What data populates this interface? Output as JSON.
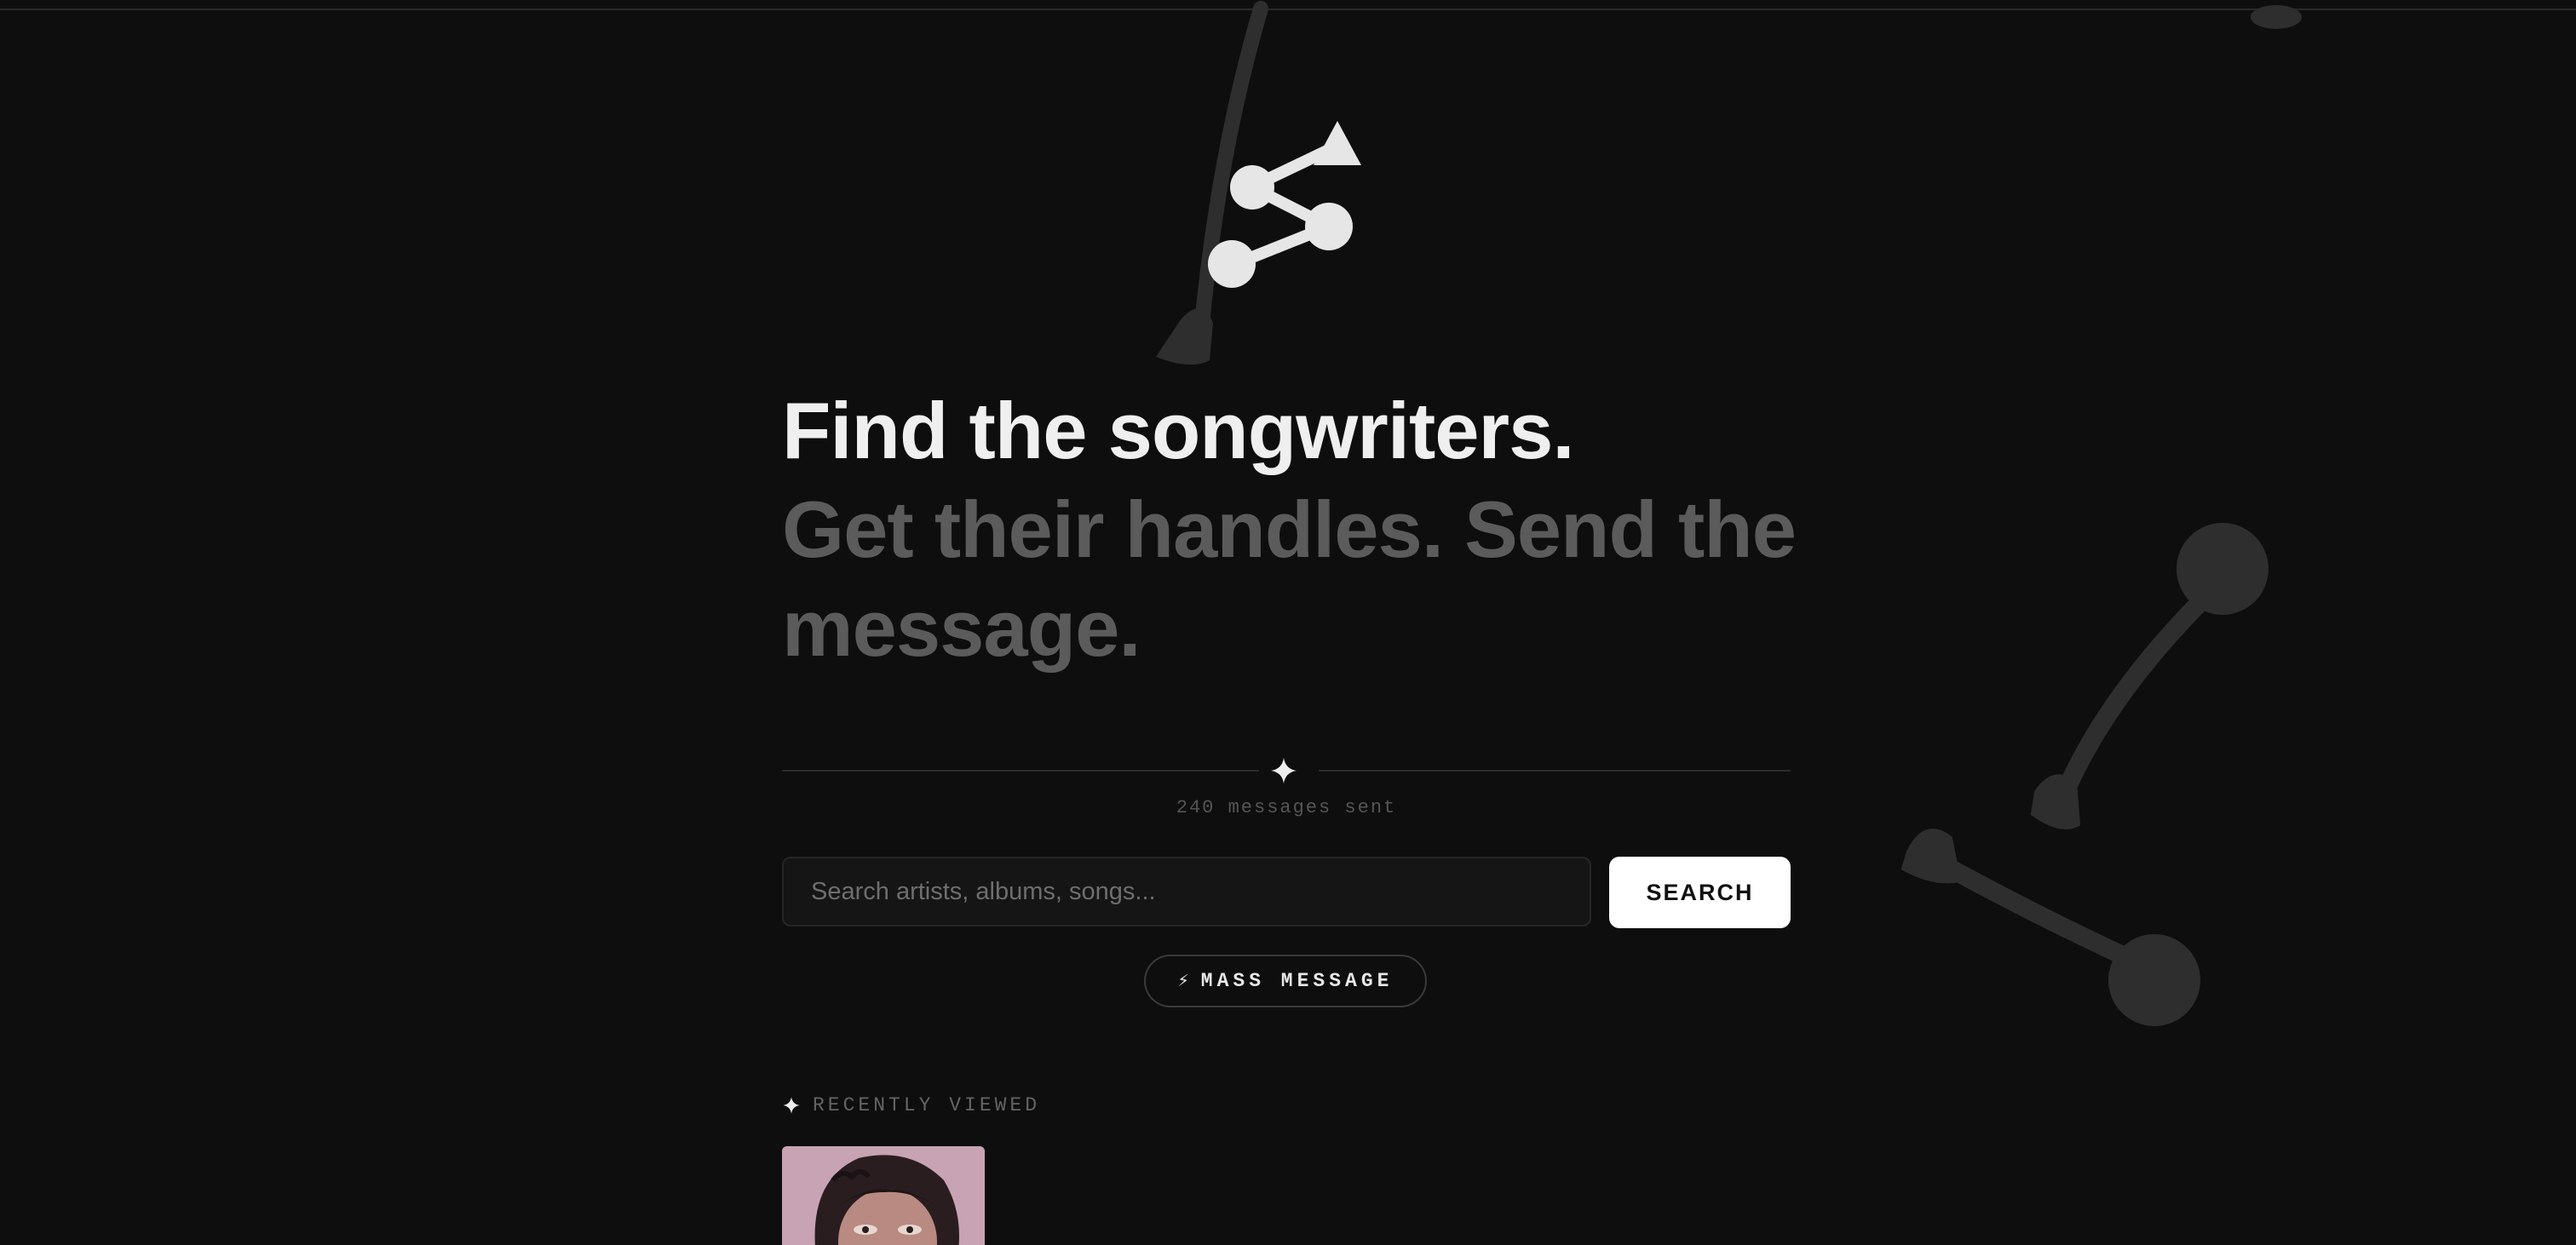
{
  "app": {
    "logo_icon": "share-network-icon"
  },
  "hero": {
    "headline_line1": "Find the songwriters.",
    "headline_line2": "Get their handles. Send the message."
  },
  "stats": {
    "messages_sent": "240 messages sent"
  },
  "search": {
    "placeholder": "Search artists, albums, songs...",
    "value": "",
    "button_label": "SEARCH"
  },
  "mass_message": {
    "icon": "lightning-icon",
    "label": "MASS MESSAGE"
  },
  "recently_viewed": {
    "heading": "RECENTLY VIEWED",
    "items": [
      {
        "thumbnail": "album-cover-image"
      }
    ]
  },
  "colors": {
    "background": "#0e0e0e",
    "headline_primary": "#efefef",
    "headline_secondary": "#5b5b5b",
    "accent_button": "#ffffff"
  }
}
